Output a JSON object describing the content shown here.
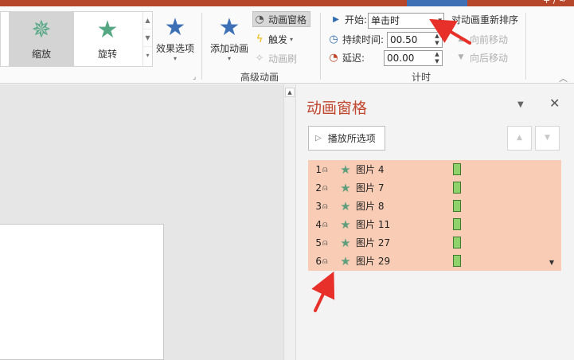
{
  "ribbon": {
    "gallery": {
      "items": [
        {
          "label": "缩放",
          "icon": "zoom-star-icon"
        },
        {
          "label": "旋转",
          "icon": "rotate-star-icon"
        }
      ]
    },
    "effect_options_label": "效果选项",
    "add_animation_label": "添加动画",
    "animation_pane_label": "动画窗格",
    "trigger_label": "触发",
    "animation_painter_label": "动画刷",
    "advanced_group_label": "高级动画",
    "timing": {
      "start_label": "开始:",
      "start_value": "单击时",
      "duration_label": "持续时间:",
      "duration_value": "00.50",
      "delay_label": "延迟:",
      "delay_value": "00.00",
      "reorder_label": "对动画重新排序",
      "move_earlier_label": "向前移动",
      "move_later_label": "向后移动",
      "group_label": "计时"
    }
  },
  "pane": {
    "title": "动画窗格",
    "play_button_label": "播放所选项",
    "items": [
      {
        "index": "1",
        "name": "图片 4"
      },
      {
        "index": "2",
        "name": "图片 7"
      },
      {
        "index": "3",
        "name": "图片 8"
      },
      {
        "index": "4",
        "name": "图片 11"
      },
      {
        "index": "5",
        "name": "图片 27"
      },
      {
        "index": "6",
        "name": "图片 29"
      }
    ]
  },
  "colors": {
    "accent_title": "#c0462c",
    "list_background": "#f9cdb5",
    "timing_bar": "#8fd16b",
    "annotation_arrow": "#e8302a",
    "brand_bar": "#b7472a"
  }
}
